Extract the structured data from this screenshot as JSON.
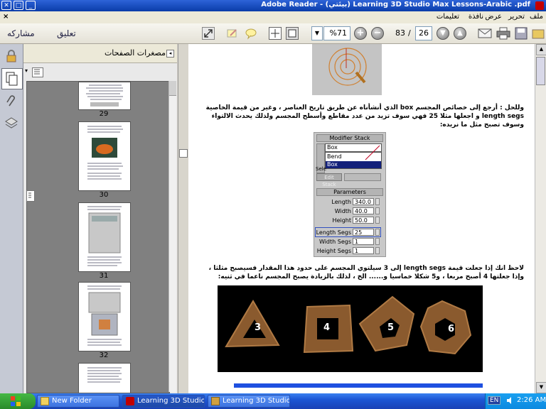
{
  "window": {
    "title": "Adobe Reader - (بيئتي) Learning 3D Studio Max Lessons-Arabic .pdf"
  },
  "menu": {
    "items": [
      "ملف",
      "تحرير",
      "عرض",
      "نافذة",
      "تعليمات"
    ],
    "close_glyph": "×"
  },
  "toolbar": {
    "share_label": "مشاركه",
    "comment_label": "تعليق",
    "zoom_value": "%71",
    "page_total": "83",
    "page_separator": "/",
    "page_current": "26"
  },
  "thumbnail_panel": {
    "title": "مصغرات الصفحات",
    "pages": [
      "29",
      "30",
      "31",
      "32"
    ]
  },
  "document": {
    "paragraph1": "وللحل : أرجع إلى خصائص المجسم box الذي أنشأناه عن طريق تاريخ العناصر ، وغير من قيمة الخاصية length segs و اجعلها مثلا 25 فهي سوف تزيد من عدد مقاطع وأسطح المجسم ولذلك يحدث الالتواء وسوف تصبح مثل ما نريده:",
    "modifier_panel": {
      "title": "Modifier Stack",
      "dropdown_value": "Box",
      "list_items": [
        "Bend",
        "Box"
      ],
      "sel_label": "Sele",
      "edit_label": "Edit Stack",
      "parameters_title": "Parameters",
      "params": [
        {
          "label": "Length",
          "value": "340.0"
        },
        {
          "label": "Width",
          "value": "40.0"
        },
        {
          "label": "Height",
          "value": "50.0"
        },
        {
          "label": "Length Segs",
          "value": "25"
        },
        {
          "label": "Width Segs",
          "value": "1"
        },
        {
          "label": "Height Segs",
          "value": "1"
        }
      ]
    },
    "paragraph2": "لاحظ انك إذا جعلت قيمة length segs إلى 3 سيلتوي المجسم على حدود هذا المقدار فسيصبح مثلثا ، وإذا جعلتها 4 أصبح مربعا ، و5 شكلا خماسيا و...... الخ ، لذلك بالزيادة يصبح المجسم ناعما في ثنيه:",
    "shape_labels": [
      "3",
      "4",
      "5",
      "6"
    ]
  },
  "taskbar": {
    "start_label": "start",
    "tasks": [
      "New Folder",
      "Learning 3D Studio Ma...",
      "Learning 3D Studio Ma..."
    ],
    "language": "EN",
    "clock": "2:26 AM"
  },
  "colors": {
    "titlebar": "#0a3ca8",
    "taskbar": "#1c56d4",
    "scroll_accent": "#1e50e0"
  }
}
